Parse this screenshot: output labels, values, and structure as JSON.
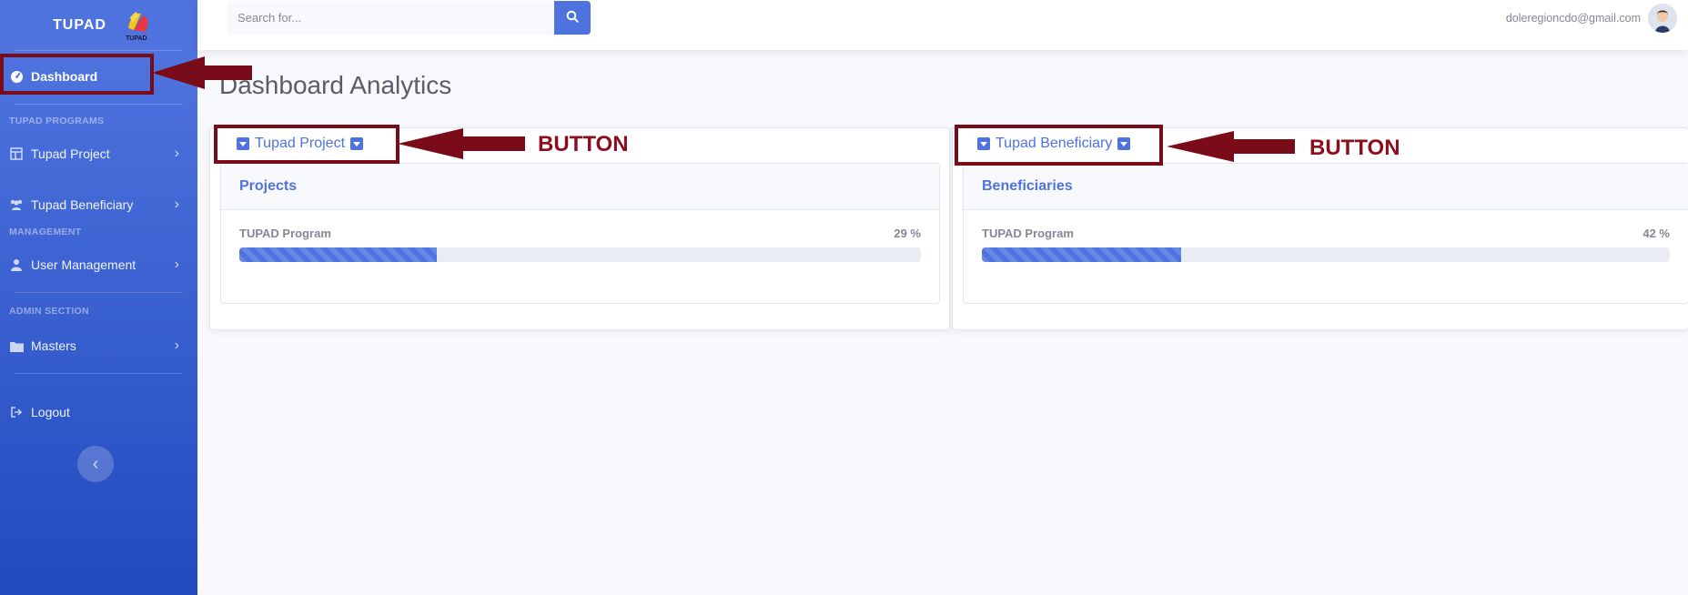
{
  "sidebar": {
    "brand": "TUPAD",
    "logo_caption": "TUPAD",
    "items": [
      {
        "label": "Dashboard",
        "icon": "dashboard-gauge-icon",
        "active": true
      },
      {
        "heading": "TUPAD PROGRAMS"
      },
      {
        "label": "Tupad Project",
        "icon": "table-icon"
      },
      {
        "label": "Tupad Beneficiary",
        "icon": "users-icon"
      },
      {
        "heading": "MANAGEMENT"
      },
      {
        "label": "User Management",
        "icon": "user-icon"
      },
      {
        "heading": "ADMIN SECTION"
      },
      {
        "label": "Masters",
        "icon": "folder-icon"
      },
      {
        "label": "Logout",
        "icon": "logout-icon"
      }
    ],
    "toggle_icon": "chevron-left-icon"
  },
  "topbar": {
    "search_placeholder": "Search for...",
    "user_email": "doleregioncdo@gmail.com"
  },
  "main": {
    "title": "Dashboard Analytics",
    "panels": [
      {
        "toggle_label": "Tupad Project",
        "card_title": "Projects",
        "metric_label": "TUPAD Program",
        "metric_value": "29 %",
        "progress": 0.29
      },
      {
        "toggle_label": "Tupad Beneficiary",
        "card_title": "Beneficiaries",
        "metric_label": "TUPAD Program",
        "metric_value": "42 %",
        "progress": 0.29
      }
    ]
  },
  "annotations": {
    "label_1": "BUTTON",
    "label_2": "BUTTON"
  },
  "colors": {
    "primary": "#4e73df",
    "annotation": "#7a0c1a"
  }
}
